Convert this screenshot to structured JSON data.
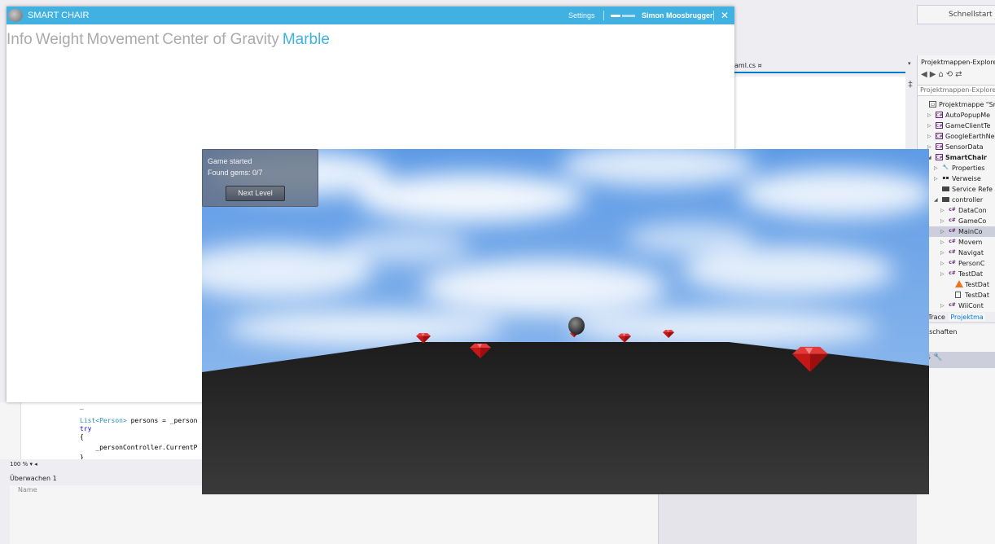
{
  "vs": {
    "quick_launch": "Schnellstart (S",
    "document_tab": "aml.cs",
    "document_tab_pin": "¤",
    "tab_dropdown": "▾",
    "split_button": "‡",
    "solution_explorer": {
      "title": "Projektmappen-Explore",
      "toolbar": "◀▶⌂⟲⇄",
      "search": "Projektmappen-Explore",
      "tree": [
        {
          "label": "Projektmappe \"Sm",
          "icon": "solution",
          "indent": 0,
          "arrow": ""
        },
        {
          "label": "AutoPopupMe",
          "icon": "csproj",
          "indent": 1,
          "arrow": "▷"
        },
        {
          "label": "GameClientTe",
          "icon": "csproj",
          "indent": 1,
          "arrow": "▷"
        },
        {
          "label": "GoogleEarthNe",
          "icon": "csproj",
          "indent": 1,
          "arrow": "▷"
        },
        {
          "label": "SensorData",
          "icon": "csproj",
          "indent": 1,
          "arrow": "▷"
        },
        {
          "label": "SmartChair",
          "icon": "csproj",
          "indent": 1,
          "arrow": "◢",
          "bold": true
        },
        {
          "label": "Properties",
          "icon": "wrench",
          "indent": 2,
          "arrow": "▷"
        },
        {
          "label": "Verweise",
          "icon": "refs",
          "indent": 2,
          "arrow": "▷"
        },
        {
          "label": "Service Refe",
          "icon": "folder",
          "indent": 2,
          "arrow": ""
        },
        {
          "label": "controller",
          "icon": "folder",
          "indent": 2,
          "arrow": "◢"
        },
        {
          "label": "DataCon",
          "icon": "cs",
          "indent": 3,
          "arrow": "▷"
        },
        {
          "label": "GameCo",
          "icon": "cs",
          "indent": 3,
          "arrow": "▷"
        },
        {
          "label": "MainCo",
          "icon": "cs",
          "indent": 3,
          "arrow": "▷",
          "selected": true
        },
        {
          "label": "Movem",
          "icon": "cs",
          "indent": 3,
          "arrow": "▷"
        },
        {
          "label": "Navigat",
          "icon": "cs",
          "indent": 3,
          "arrow": "▷"
        },
        {
          "label": "PersonC",
          "icon": "cs",
          "indent": 3,
          "arrow": "▷"
        },
        {
          "label": "TestDat",
          "icon": "cs",
          "indent": 3,
          "arrow": "▷"
        },
        {
          "label": "TestDat",
          "icon": "cone",
          "indent": 4,
          "arrow": ""
        },
        {
          "label": "TestDat",
          "icon": "file",
          "indent": 4,
          "arrow": ""
        },
        {
          "label": "WiiCont",
          "icon": "cs",
          "indent": 3,
          "arrow": "▷"
        }
      ],
      "bottom_tabs": [
        "elliTrace",
        "Projektma"
      ],
      "properties_title": "genschaften"
    },
    "props_icons": "⁝ ⇅ 🔧",
    "code": {
      "line1": "_",
      "line2_type": "List<Person>",
      "line2_rest": " persons = _person",
      "line3": "try",
      "line4": "{",
      "line5": "    _personController.CurrentP",
      "line6": "}"
    },
    "zoom": "100 %",
    "zoom_dd": "▾ ◂",
    "watch_title": "Überwachen 1",
    "watch_column": "Name"
  },
  "app": {
    "title": "SMART CHAIR",
    "settings": "Settings",
    "user": "Simon Moosbrugger",
    "close": "✕",
    "nav": [
      {
        "label": "Info",
        "active": false
      },
      {
        "label": "Weight",
        "active": false
      },
      {
        "label": "Movement",
        "active": false
      },
      {
        "label": "Center of Gravity",
        "active": false
      },
      {
        "label": "Marble",
        "active": true
      }
    ],
    "accent": "#41b1e1"
  },
  "game": {
    "status": "Game started",
    "gems_text": "Found gems: 0/7",
    "next_level": "Next Level",
    "found_gems": 0,
    "total_gems": 7,
    "gem_color": "#c41818",
    "sky_color": "#6fa6e8",
    "floor_color": "#2a2a2a"
  }
}
